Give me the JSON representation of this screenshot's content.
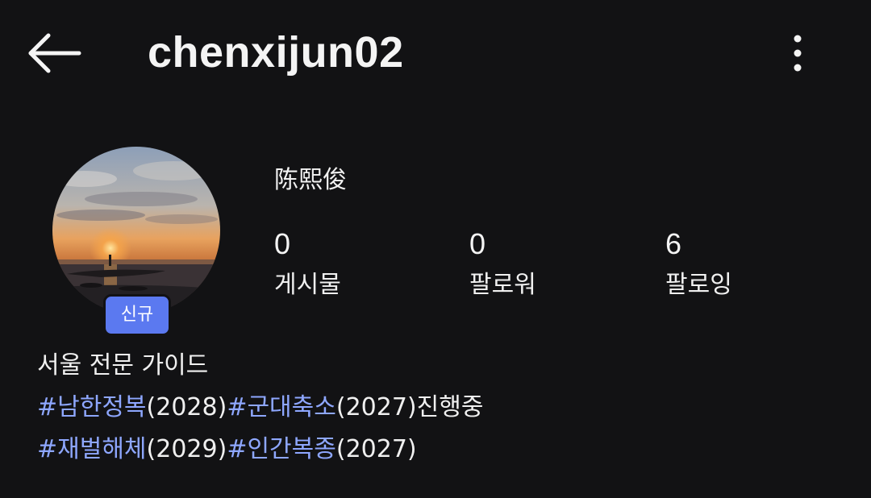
{
  "header": {
    "username": "chenxijun02",
    "back_icon": "arrow-left-icon",
    "more_icon": "kebab-menu-icon"
  },
  "profile": {
    "avatar_icon": "sunset-sea-photo",
    "badge": "신규",
    "display_name": "陈熙俊",
    "stats": [
      {
        "value": "0",
        "label": "게시물"
      },
      {
        "value": "0",
        "label": "팔로워"
      },
      {
        "value": "6",
        "label": "팔로잉"
      }
    ]
  },
  "bio": {
    "line1": "서울 전문 가이드",
    "line2": {
      "tag1": "#남한정복",
      "text1": "(2028)",
      "tag2": "#군대축소",
      "text2": "(2027)진행중"
    },
    "line3": {
      "tag1": "#재벌해체",
      "text1": "(2029)",
      "tag2": "#인간복종",
      "text2": "(2027)"
    }
  },
  "colors": {
    "background": "#121214",
    "text": "#f2f2f2",
    "hashtag": "#8ea7ff",
    "badge": "#5b79f0"
  }
}
